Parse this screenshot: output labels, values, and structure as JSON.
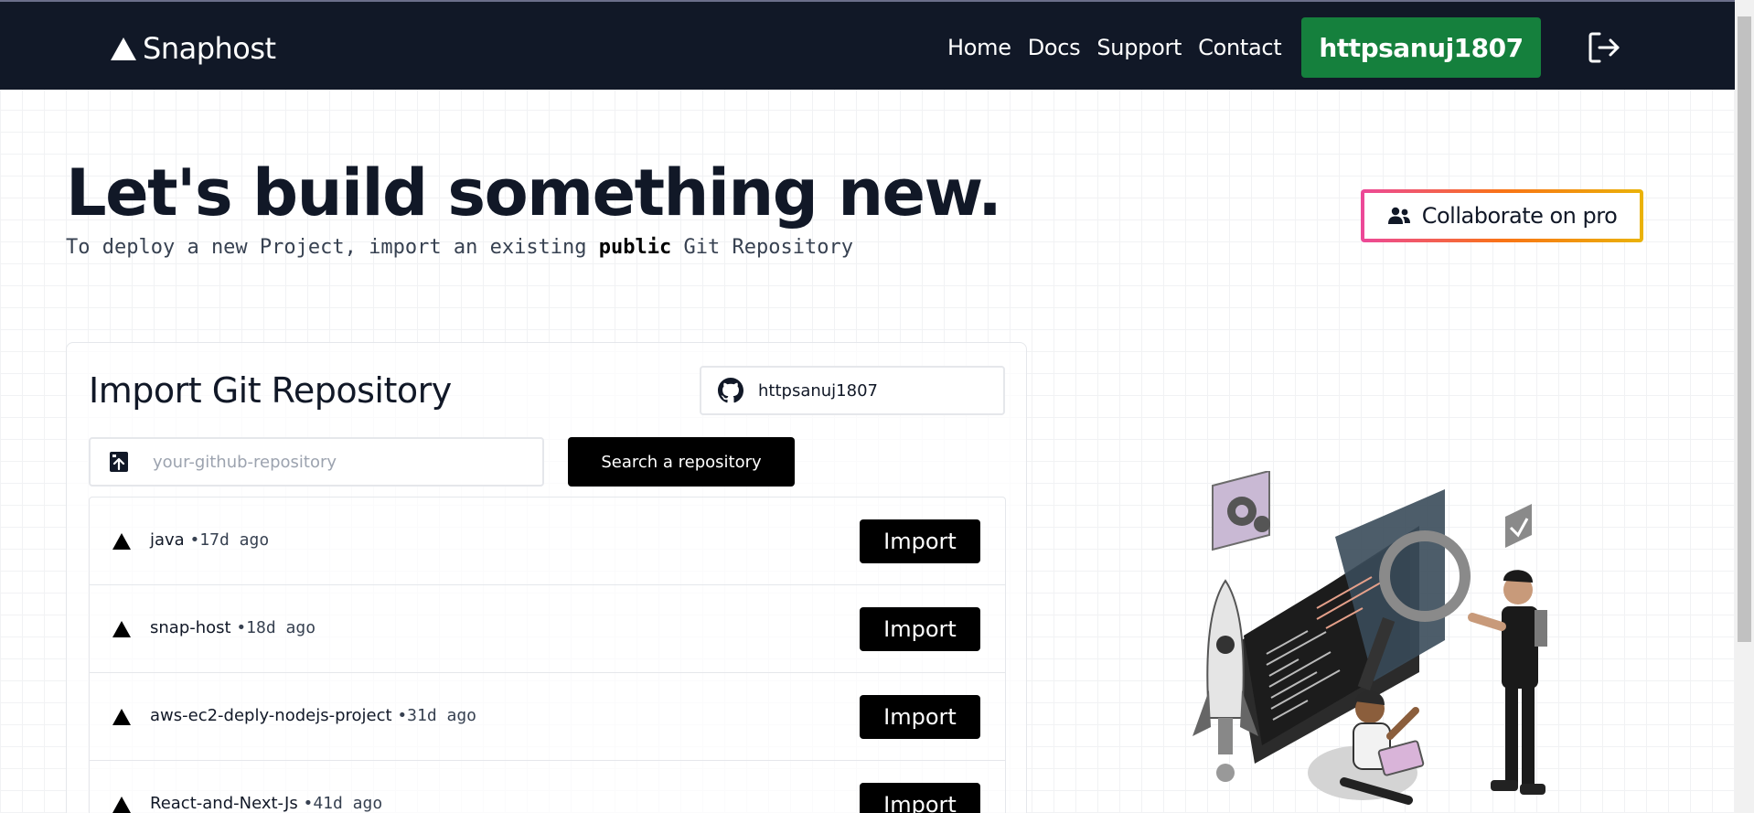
{
  "navbar": {
    "brand": "Snaphost",
    "links": [
      "Home",
      "Docs",
      "Support",
      "Contact"
    ],
    "user_button": "httpsanuj1807",
    "logout_icon": "logout-icon"
  },
  "hero": {
    "title": "Let's build something new.",
    "subtitle_before": "To deploy a new Project, import an existing ",
    "subtitle_bold": "public",
    "subtitle_after": " Git Repository",
    "collab_label": "Collaborate on pro",
    "collab_icon": "users-icon"
  },
  "import_card": {
    "title": "Import Git Repository",
    "github_user": "httpsanuj1807",
    "search_placeholder": "your-github-repository",
    "search_value": "",
    "search_button": "Search a repository",
    "repos": [
      {
        "name": "java",
        "time": "17d ago"
      },
      {
        "name": "snap-host",
        "time": "18d ago"
      },
      {
        "name": "aws-ec2-deply-nodejs-project",
        "time": "31d ago"
      },
      {
        "name": "React-and-Next-Js",
        "time": "41d ago"
      }
    ],
    "import_label": "Import"
  },
  "colors": {
    "navbar_bg": "#111827",
    "user_button_bg": "#15803d",
    "collab_gradient": [
      "#ec4899",
      "#eab308"
    ],
    "button_black": "#000000"
  }
}
